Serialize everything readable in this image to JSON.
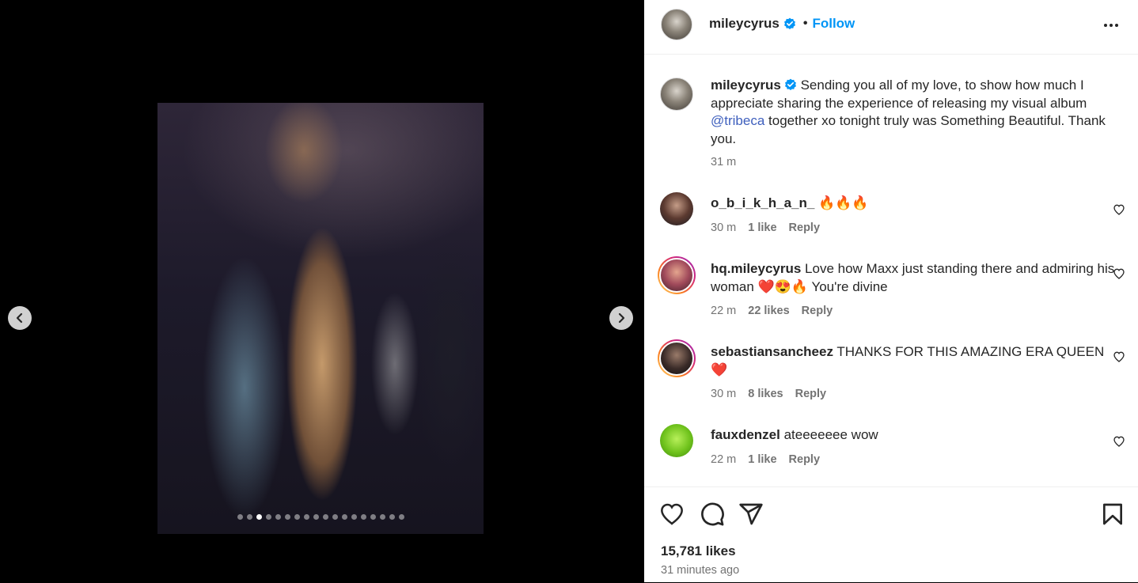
{
  "post": {
    "username": "mileycyrus",
    "separator": "•",
    "follow_label": "Follow",
    "more_icon": "more-options-icon",
    "carousel": {
      "total_slides": 18,
      "active_index": 2
    },
    "caption": {
      "username": "mileycyrus",
      "text_before": " Sending you all of my love, to show how much I appreciate sharing the experience of releasing my visual album ",
      "mention": "@tribeca",
      "text_after": " together xo tonight truly was Something Beautiful. Thank you.",
      "time": "31 m"
    },
    "comments": [
      {
        "username": "o_b_i_k_h_a_n_",
        "text": " 🔥🔥🔥",
        "time": "30 m",
        "likes": "1 like",
        "reply": "Reply"
      },
      {
        "username": "hq.mileycyrus",
        "text": " Love how Maxx just standing there and admiring his woman ❤️😍🔥 You're divine",
        "time": "22 m",
        "likes": "22 likes",
        "reply": "Reply"
      },
      {
        "username": "sebastiansancheez",
        "text": " THANKS FOR THIS AMAZING ERA QUEEN ❤️",
        "time": "30 m",
        "likes": "8 likes",
        "reply": "Reply"
      },
      {
        "username": "fauxdenzel",
        "text": " ateeeeeee wow",
        "time": "22 m",
        "likes": "1 like",
        "reply": "Reply"
      }
    ],
    "likes_count": "15,781 likes",
    "posted_ago": "31 minutes ago"
  },
  "colors": {
    "accent": "#0095f6",
    "mention": "#3e5fbd",
    "muted": "#737373",
    "verified": "#0095f6"
  }
}
